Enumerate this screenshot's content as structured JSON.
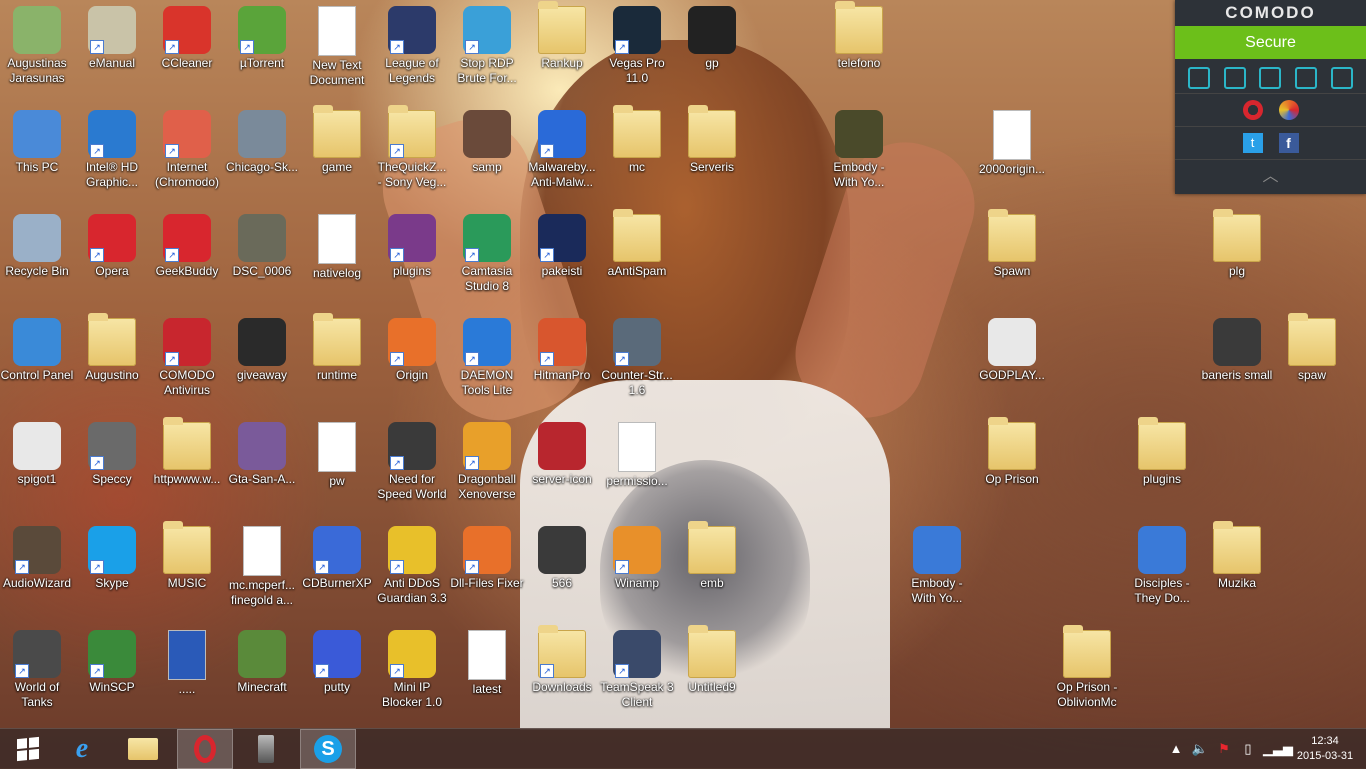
{
  "desktop": {
    "icons": [
      {
        "label": "Augustinas Jarasunas",
        "kind": "user",
        "color": "#8ab36a",
        "shortcut": false
      },
      {
        "label": "eManual",
        "kind": "app",
        "color": "#c9c3a8",
        "shortcut": true
      },
      {
        "label": "CCleaner",
        "kind": "app",
        "color": "#d9342b",
        "shortcut": true
      },
      {
        "label": "µTorrent",
        "kind": "app",
        "color": "#5aa43a",
        "shortcut": true
      },
      {
        "label": "New Text Document",
        "kind": "doc",
        "color": "#ffffff",
        "shortcut": false
      },
      {
        "label": "League of Legends",
        "kind": "app",
        "color": "#2c3a6a",
        "shortcut": true
      },
      {
        "label": "Stop RDP Brute For...",
        "kind": "app",
        "color": "#3aa0d8",
        "shortcut": true
      },
      {
        "label": "Rankup",
        "kind": "folder",
        "color": "#e6c46a",
        "shortcut": false
      },
      {
        "label": "Vegas Pro 11.0",
        "kind": "app",
        "color": "#1a2a3a",
        "shortcut": true
      },
      {
        "label": "gp",
        "kind": "app",
        "color": "#222222",
        "shortcut": false
      },
      {
        "label": "telefono",
        "kind": "folder",
        "color": "#e6c46a",
        "shortcut": false
      },
      {
        "label": "This PC",
        "kind": "app",
        "color": "#4a8ad8",
        "shortcut": false
      },
      {
        "label": "Intel® HD Graphic...",
        "kind": "app",
        "color": "#2a7ad0",
        "shortcut": true
      },
      {
        "label": "Internet (Chromodo)",
        "kind": "app",
        "color": "#e0604a",
        "shortcut": true
      },
      {
        "label": "Chicago-Sk...",
        "kind": "app",
        "color": "#7a8a9a",
        "shortcut": false
      },
      {
        "label": "game",
        "kind": "folder",
        "color": "#e6c46a",
        "shortcut": false
      },
      {
        "label": "TheQuickZ... - Sony Veg...",
        "kind": "folder",
        "color": "#e6c46a",
        "shortcut": true
      },
      {
        "label": "samp",
        "kind": "app",
        "color": "#6a4a3a",
        "shortcut": false
      },
      {
        "label": "Malwareby... Anti-Malw...",
        "kind": "app",
        "color": "#2a6ad8",
        "shortcut": true
      },
      {
        "label": "mc",
        "kind": "folder",
        "color": "#e6c46a",
        "shortcut": false
      },
      {
        "label": "Serveris",
        "kind": "folder",
        "color": "#e6c46a",
        "shortcut": false
      },
      {
        "label": "Embody - With Yo...",
        "kind": "app",
        "color": "#4a4a2a",
        "shortcut": false
      },
      {
        "label": "2000origin...",
        "kind": "doc",
        "color": "#ffffff",
        "shortcut": false
      },
      {
        "label": "Recycle Bin",
        "kind": "app",
        "color": "#9ab0c8",
        "shortcut": false
      },
      {
        "label": "Opera",
        "kind": "app",
        "color": "#d8262e",
        "shortcut": true
      },
      {
        "label": "GeekBuddy",
        "kind": "app",
        "color": "#d8262e",
        "shortcut": true
      },
      {
        "label": "DSC_0006",
        "kind": "app",
        "color": "#6a6a5a",
        "shortcut": false
      },
      {
        "label": "nativelog",
        "kind": "doc",
        "color": "#ffffff",
        "shortcut": false
      },
      {
        "label": "plugins",
        "kind": "app",
        "color": "#7a3a8a",
        "shortcut": true
      },
      {
        "label": "Camtasia Studio 8",
        "kind": "app",
        "color": "#2a9a5a",
        "shortcut": true
      },
      {
        "label": "pakeisti",
        "kind": "app",
        "color": "#1a2a5a",
        "shortcut": true
      },
      {
        "label": "aAntiSpam",
        "kind": "folder",
        "color": "#e6c46a",
        "shortcut": false
      },
      {
        "label": "Spawn",
        "kind": "folder",
        "color": "#e6c46a",
        "shortcut": false
      },
      {
        "label": "plg",
        "kind": "folder",
        "color": "#e6c46a",
        "shortcut": false
      },
      {
        "label": "Control Panel",
        "kind": "app",
        "color": "#3a8ad8",
        "shortcut": false
      },
      {
        "label": "Augustino",
        "kind": "folder",
        "color": "#e6c46a",
        "shortcut": false
      },
      {
        "label": "COMODO Antivirus",
        "kind": "app",
        "color": "#c8262e",
        "shortcut": true
      },
      {
        "label": "giveaway",
        "kind": "app",
        "color": "#2a2a2a",
        "shortcut": false
      },
      {
        "label": "runtime",
        "kind": "folder",
        "color": "#e6c46a",
        "shortcut": false
      },
      {
        "label": "Origin",
        "kind": "app",
        "color": "#e8702a",
        "shortcut": true
      },
      {
        "label": "DAEMON Tools Lite",
        "kind": "app",
        "color": "#2a7ad8",
        "shortcut": true
      },
      {
        "label": "HitmanPro",
        "kind": "app",
        "color": "#d8562e",
        "shortcut": true
      },
      {
        "label": "Counter-Str... 1.6",
        "kind": "app",
        "color": "#5a6a7a",
        "shortcut": true
      },
      {
        "label": "GODPLAY...",
        "kind": "app",
        "color": "#e8e8e8",
        "shortcut": false
      },
      {
        "label": "baneris small",
        "kind": "app",
        "color": "#3a3a3a",
        "shortcut": false
      },
      {
        "label": "spaw",
        "kind": "folder",
        "color": "#e6c46a",
        "shortcut": false
      },
      {
        "label": "spigot1",
        "kind": "app",
        "color": "#e8e8e8",
        "shortcut": false
      },
      {
        "label": "Speccy",
        "kind": "app",
        "color": "#6a6a6a",
        "shortcut": true
      },
      {
        "label": "httpwww.w...",
        "kind": "folder",
        "color": "#e6c46a",
        "shortcut": false
      },
      {
        "label": "Gta-San-A...",
        "kind": "app",
        "color": "#7a5a9a",
        "shortcut": false
      },
      {
        "label": "pw",
        "kind": "doc",
        "color": "#ffffff",
        "shortcut": false
      },
      {
        "label": "Need for Speed World",
        "kind": "app",
        "color": "#3a3a3a",
        "shortcut": true
      },
      {
        "label": "Dragonball Xenoverse",
        "kind": "app",
        "color": "#e8a02a",
        "shortcut": true
      },
      {
        "label": "server-icon",
        "kind": "app",
        "color": "#b8262e",
        "shortcut": false
      },
      {
        "label": "permissio...",
        "kind": "doc",
        "color": "#ffffff",
        "shortcut": false
      },
      {
        "label": "Op Prison",
        "kind": "folder",
        "color": "#e6c46a",
        "shortcut": false
      },
      {
        "label": "plugins",
        "kind": "folder",
        "color": "#e6c46a",
        "shortcut": false
      },
      {
        "label": "AudioWizard",
        "kind": "app",
        "color": "#5a4a3a",
        "shortcut": true
      },
      {
        "label": "Skype",
        "kind": "app",
        "color": "#1aa0e8",
        "shortcut": true
      },
      {
        "label": "MUSIC",
        "kind": "folder",
        "color": "#e6c46a",
        "shortcut": false
      },
      {
        "label": "mc.mcperf... finegold a...",
        "kind": "doc",
        "color": "#ffffff",
        "shortcut": false
      },
      {
        "label": "CDBurnerXP",
        "kind": "app",
        "color": "#3a6ad8",
        "shortcut": true
      },
      {
        "label": "Anti DDoS Guardian 3.3",
        "kind": "app",
        "color": "#e8c02a",
        "shortcut": true
      },
      {
        "label": "Dll-Files Fixer",
        "kind": "app",
        "color": "#e8702a",
        "shortcut": true
      },
      {
        "label": "566",
        "kind": "app",
        "color": "#3a3a3a",
        "shortcut": false
      },
      {
        "label": "Winamp",
        "kind": "app",
        "color": "#e8902a",
        "shortcut": true
      },
      {
        "label": "emb",
        "kind": "folder",
        "color": "#e6c46a",
        "shortcut": false
      },
      {
        "label": "Embody - With Yo...",
        "kind": "app",
        "color": "#3a7ad8",
        "shortcut": false
      },
      {
        "label": "Disciples - They Do...",
        "kind": "app",
        "color": "#3a7ad8",
        "shortcut": false
      },
      {
        "label": "Muzika",
        "kind": "folder",
        "color": "#e6c46a",
        "shortcut": false
      },
      {
        "label": "World of Tanks",
        "kind": "app",
        "color": "#4a4a4a",
        "shortcut": true
      },
      {
        "label": "WinSCP",
        "kind": "app",
        "color": "#3a8a3a",
        "shortcut": true
      },
      {
        "label": ".....",
        "kind": "doc",
        "color": "#2a5ab8",
        "shortcut": false
      },
      {
        "label": "Minecraft",
        "kind": "app",
        "color": "#5a8a3a",
        "shortcut": false
      },
      {
        "label": "putty",
        "kind": "app",
        "color": "#3a5ad8",
        "shortcut": true
      },
      {
        "label": "Mini IP Blocker 1.0",
        "kind": "app",
        "color": "#e8c02a",
        "shortcut": true
      },
      {
        "label": "latest",
        "kind": "doc",
        "color": "#ffffff",
        "shortcut": false
      },
      {
        "label": "Downloads",
        "kind": "folder",
        "color": "#e6c46a",
        "shortcut": true
      },
      {
        "label": "TeamSpeak 3 Client",
        "kind": "app",
        "color": "#3a4a6a",
        "shortcut": true
      },
      {
        "label": "Untitled9",
        "kind": "folder",
        "color": "#e6c46a",
        "shortcut": false
      },
      {
        "label": "Op Prison - OblivionMc",
        "kind": "folder",
        "color": "#e6c46a",
        "shortcut": false
      }
    ]
  },
  "comodo": {
    "brand": "COMODO",
    "status": "Secure",
    "status_color": "#6cbf1a"
  },
  "taskbar": {
    "apps": [
      {
        "name": "start-button",
        "icon": "windows-icon",
        "active": false
      },
      {
        "name": "internet-explorer",
        "icon": "ie-icon",
        "active": false
      },
      {
        "name": "file-explorer",
        "icon": "folder-icon",
        "active": false
      },
      {
        "name": "opera",
        "icon": "opera-icon",
        "active": true
      },
      {
        "name": "speccy",
        "icon": "speccy-icon",
        "active": false
      },
      {
        "name": "skype",
        "icon": "skype-icon",
        "active": true
      }
    ],
    "clock": {
      "time": "12:34",
      "date": "2015-03-31"
    }
  }
}
